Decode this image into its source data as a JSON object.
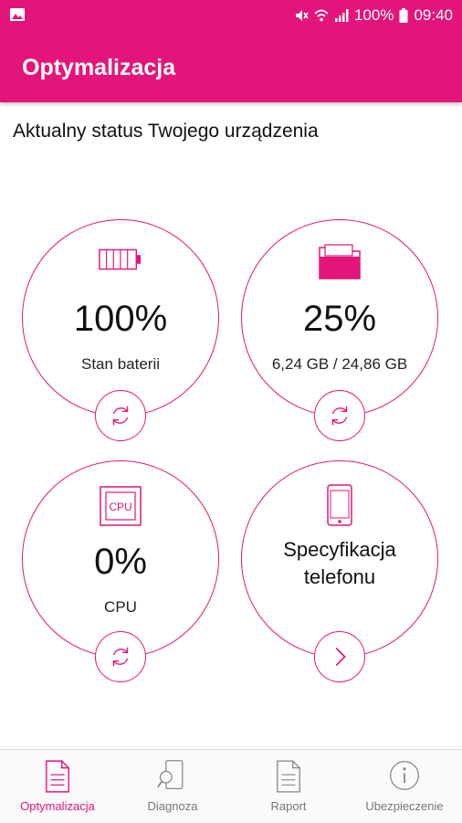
{
  "status_bar": {
    "battery": "100%",
    "time": "09:40"
  },
  "app_bar": {
    "title": "Optymalizacja"
  },
  "subtitle": "Aktualny status Twojego urządzenia",
  "tiles": [
    {
      "id": "battery",
      "value": "100%",
      "label": "Stan baterii",
      "icon": "battery-icon",
      "action_icon": "refresh-icon"
    },
    {
      "id": "storage",
      "value": "25%",
      "label": "6,24 GB / 24,86 GB",
      "icon": "folder-icon",
      "action_icon": "refresh-icon"
    },
    {
      "id": "cpu",
      "value": "0%",
      "label": "CPU",
      "icon": "cpu-icon",
      "icon_text": "CPU",
      "action_icon": "refresh-icon"
    },
    {
      "id": "spec",
      "title_line1": "Specyfikacja",
      "title_line2": "telefonu",
      "icon": "phone-icon",
      "action_icon": "chevron-right-icon"
    }
  ],
  "bottom_nav": [
    {
      "label": "Optymalizacja",
      "icon": "document-icon",
      "active": true
    },
    {
      "label": "Diagnoza",
      "icon": "phone-search-icon",
      "active": false
    },
    {
      "label": "Raport",
      "icon": "report-icon",
      "active": false
    },
    {
      "label": "Ubezpieczenie",
      "icon": "info-icon",
      "active": false
    }
  ],
  "colors": {
    "accent": "#e3157a",
    "text": "#111111",
    "nav_inactive": "#777777"
  }
}
